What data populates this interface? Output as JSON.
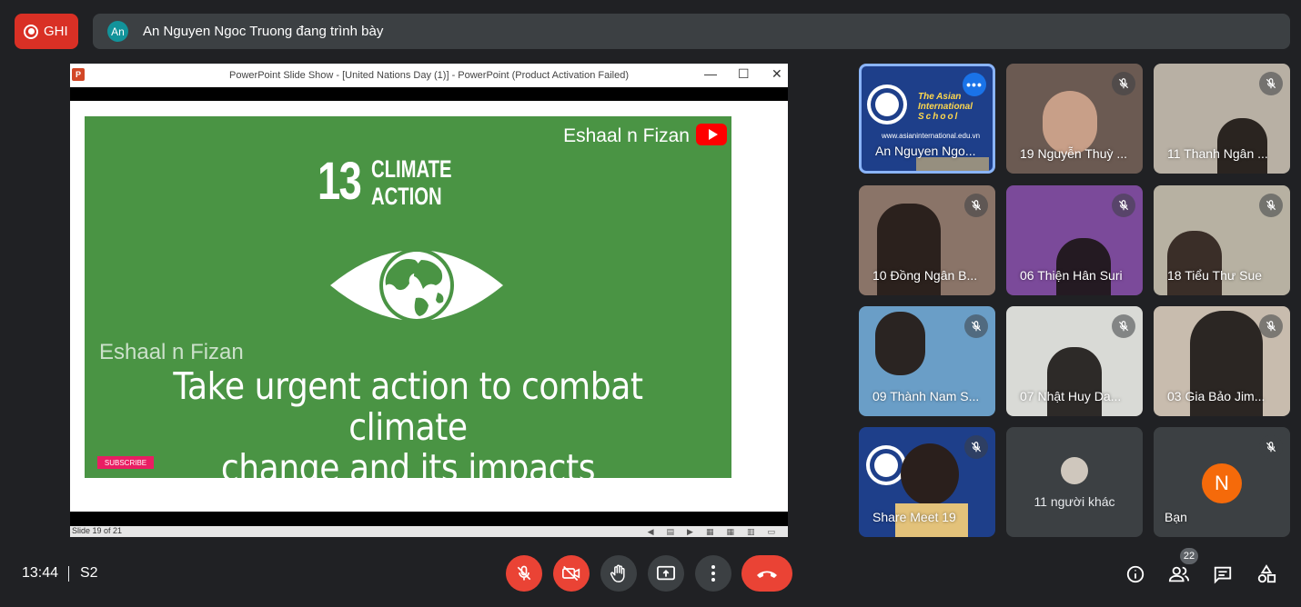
{
  "topbar": {
    "record_label": "GHI",
    "presenter_initials": "An",
    "presenter_text": "An Nguyen Ngoc Truong đang trình bày"
  },
  "presentation": {
    "window_title": "PowerPoint Slide Show - [United Nations Day (1)] - PowerPoint (Product Activation Failed)",
    "ppt_logo": "P",
    "minimize": "—",
    "maximize": "☐",
    "close": "✕",
    "slide": {
      "channel": "Eshaal n Fizan",
      "sdg_number": "13",
      "sdg_line1": "CLIMATE",
      "sdg_line2": "ACTION",
      "watermark": "Eshaal n Fizan",
      "goal_line1": "Take urgent action to combat climate",
      "goal_line2": "change and its impacts",
      "subscribe": "SUBSCRIBE"
    },
    "status": "Slide 19 of 21"
  },
  "participants": [
    {
      "name": "An Nguyen Ngo...",
      "active": true
    },
    {
      "name": "19 Nguyễn Thuỳ ..."
    },
    {
      "name": "11 Thanh Ngân ..."
    },
    {
      "name": "10 Đồng Ngân B..."
    },
    {
      "name": "06 Thiện Hân Suri"
    },
    {
      "name": "18 Tiểu Thư Sue"
    },
    {
      "name": "09 Thành Nam S..."
    },
    {
      "name": "07 Nhật Huy Da..."
    },
    {
      "name": "03 Gia Bảo Jim..."
    },
    {
      "name": "Share Meet 19"
    },
    {
      "name": "11 người khác"
    },
    {
      "name": "Bạn",
      "initial": "N"
    }
  ],
  "tile_texts": {
    "school_line1": "The Asian",
    "school_line2": "International",
    "school_line3": "School",
    "school_url": "www.asianinternational.edu.vn"
  },
  "bottombar": {
    "time": "13:44",
    "meeting_code": "S2",
    "people_count": "22"
  },
  "colors": {
    "background": "#202124",
    "record": "#d93025",
    "end_call": "#ea4335",
    "active_border": "#8ab4f8",
    "slide_green": "#4a9444",
    "you_avatar": "#f56a0a"
  }
}
